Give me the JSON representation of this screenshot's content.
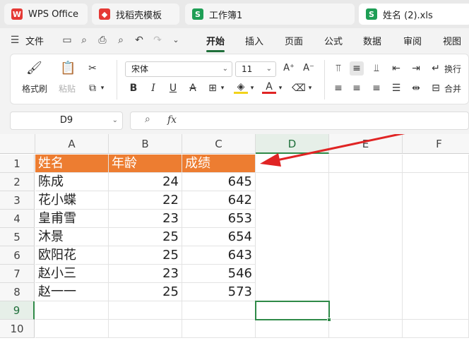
{
  "tabs": [
    {
      "label": "WPS Office",
      "icon": "wps-logo-icon"
    },
    {
      "label": "找稻壳模板",
      "icon": "docer-icon"
    },
    {
      "label": "工作簿1",
      "icon": "spreadsheet-icon"
    },
    {
      "label": "姓名 (2).xls",
      "icon": "spreadsheet-icon"
    }
  ],
  "menu": {
    "file": "文件",
    "items": [
      "开始",
      "插入",
      "页面",
      "公式",
      "数据",
      "审阅",
      "视图"
    ],
    "active": "开始"
  },
  "ribbon": {
    "format_painter": "格式刷",
    "paste": "粘贴",
    "font_name": "宋体",
    "font_size": "11",
    "bold": "B",
    "italic": "I",
    "underline": "U",
    "strike": "A",
    "wrap": "换行",
    "merge": "合并"
  },
  "formula_bar": {
    "name_box": "D9",
    "fx": "fx",
    "formula": ""
  },
  "columns": [
    "A",
    "B",
    "C",
    "D",
    "E",
    "F"
  ],
  "rows": [
    "1",
    "2",
    "3",
    "4",
    "5",
    "6",
    "7",
    "8",
    "9",
    "10"
  ],
  "table": {
    "header": [
      "姓名",
      "年龄",
      "成绩"
    ],
    "data": [
      [
        "陈成",
        "24",
        "645"
      ],
      [
        "花小蝶",
        "22",
        "642"
      ],
      [
        "皇甫雪",
        "23",
        "653"
      ],
      [
        "沐景",
        "25",
        "654"
      ],
      [
        "欧阳花",
        "25",
        "643"
      ],
      [
        "赵小三",
        "23",
        "546"
      ],
      [
        "赵一一",
        "25",
        "573"
      ]
    ]
  },
  "selected_cell": "D9",
  "colors": {
    "header_fill": "#ed7d31",
    "accent_green": "#2f8a48",
    "annotation_arrow": "#e02424"
  }
}
